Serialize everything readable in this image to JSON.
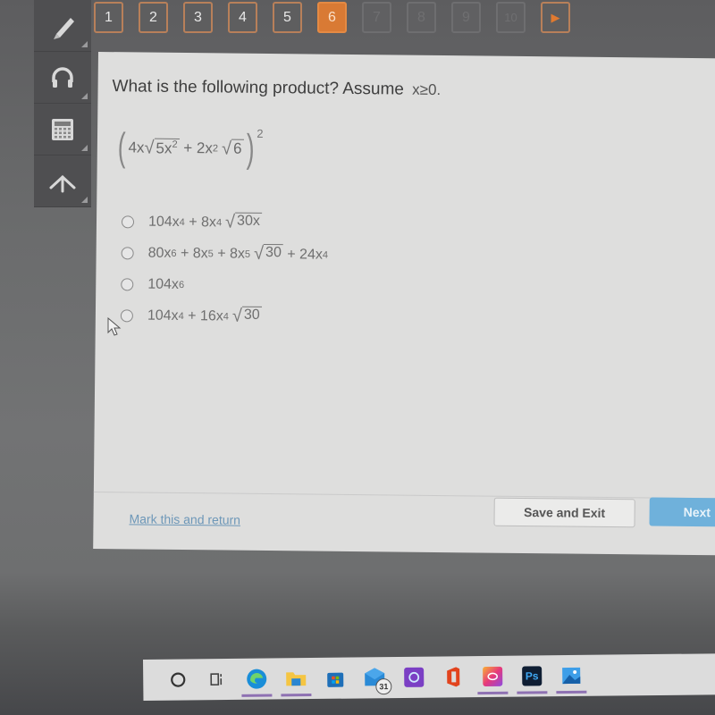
{
  "question_nav": {
    "items": [
      {
        "label": "1",
        "state": "answered"
      },
      {
        "label": "2",
        "state": "answered"
      },
      {
        "label": "3",
        "state": "answered"
      },
      {
        "label": "4",
        "state": "answered"
      },
      {
        "label": "5",
        "state": "answered"
      },
      {
        "label": "6",
        "state": "current"
      },
      {
        "label": "7",
        "state": "disabled"
      },
      {
        "label": "8",
        "state": "disabled"
      },
      {
        "label": "9",
        "state": "disabled"
      },
      {
        "label": "10",
        "state": "disabled"
      }
    ],
    "next_arrow": "▶",
    "accent_color": "#d97a34"
  },
  "toolbar": {
    "items": [
      {
        "name": "pencil",
        "icon": "pencil-icon"
      },
      {
        "name": "audio",
        "icon": "headphones-icon"
      },
      {
        "name": "calculator",
        "icon": "calculator-icon"
      },
      {
        "name": "reference",
        "icon": "compass-icon"
      }
    ]
  },
  "question": {
    "prompt": "What is the following product? Assume",
    "condition": "x≥0.",
    "expression": {
      "open_paren": "(",
      "term1_coef": "4x",
      "term1_radicand": "5x",
      "term1_radicand_exp": "2",
      "plus": " + ",
      "term2_coef": "2x",
      "term2_exp": "2",
      "term2_radicand": "6",
      "close_paren": ")",
      "outer_exp": "2"
    },
    "options": [
      {
        "parts": [
          "104x",
          "4",
          " + 8x",
          "4",
          "30x",
          ""
        ],
        "text": "104x⁴ + 8x⁴√30x"
      },
      {
        "parts": [
          "80x",
          "6",
          " + 8x",
          "5",
          " + 8x",
          "5",
          "30",
          " + 24x",
          "4"
        ],
        "text": "80x⁶ + 8x⁵ + 8x⁵√30 + 24x⁴"
      },
      {
        "parts": [
          "104x",
          "6"
        ],
        "text": "104x⁶"
      },
      {
        "parts": [
          "104x",
          "4",
          " + 16x",
          "4",
          "30"
        ],
        "text": "104x⁴ + 16x⁴√30"
      }
    ]
  },
  "footer": {
    "mark_link": "Mark this and return",
    "save_button": "Save and Exit",
    "next_button": "Next",
    "link_color": "#6d97b8",
    "next_color": "#6fb1db"
  },
  "taskbar": {
    "items": [
      {
        "name": "search",
        "icon": "cortana-circle-icon",
        "running": false
      },
      {
        "name": "task-view",
        "icon": "task-view-icon",
        "running": false
      },
      {
        "name": "edge",
        "icon": "edge-icon",
        "running": true
      },
      {
        "name": "file-explorer",
        "icon": "folder-icon",
        "running": true
      },
      {
        "name": "store",
        "icon": "store-icon",
        "running": false
      },
      {
        "name": "mail",
        "icon": "mail-icon",
        "running": false,
        "badge": "31"
      },
      {
        "name": "cortana-app",
        "icon": "cortana-app-icon",
        "running": false
      },
      {
        "name": "office",
        "icon": "office-icon",
        "running": false
      },
      {
        "name": "creative-cloud",
        "icon": "creative-cloud-icon",
        "running": true
      },
      {
        "name": "photoshop",
        "icon": "photoshop-icon",
        "running": true,
        "label": "Ps"
      },
      {
        "name": "photos",
        "icon": "photos-icon",
        "running": true
      }
    ]
  }
}
